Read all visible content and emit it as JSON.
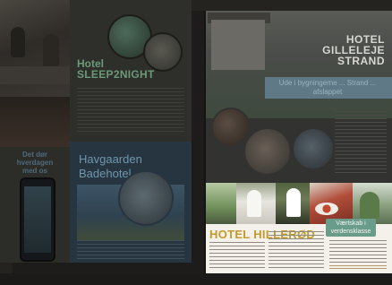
{
  "left_page": {
    "sleep2night": {
      "line1": "Hotel",
      "line2": "SLEEP2NIGHT"
    },
    "phone_ad": {
      "text": "Det dør hverdagen med os"
    },
    "havgaard": {
      "line1": "Havgaarden",
      "line2": "Badehotel"
    }
  },
  "right_page": {
    "gilleleje": {
      "title": "HOTEL GILLELEJE STRAND",
      "band_text": "Ude i bygningerne ... Strand ... afslappet"
    },
    "hillerod": {
      "title": "HOTEL HILLERØD",
      "badge": "Værtskab i verdensklasse"
    }
  },
  "colors": {
    "sleep_title": "#6b9a78",
    "havgaard_title": "#6f97ad",
    "hillerod_title": "#c59a2c",
    "badge_bg": "#6a9c8c"
  }
}
